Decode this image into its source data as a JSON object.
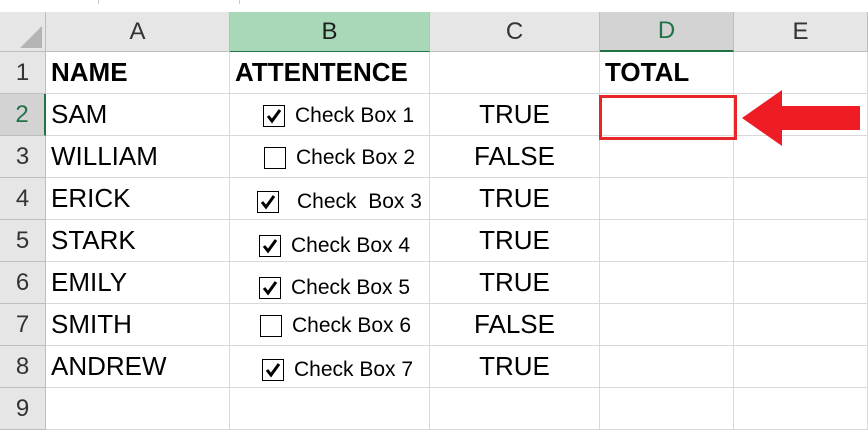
{
  "columns": [
    "A",
    "B",
    "C",
    "D",
    "E"
  ],
  "rows": [
    "1",
    "2",
    "3",
    "4",
    "5",
    "6",
    "7",
    "8",
    "9"
  ],
  "header": {
    "name": "NAME",
    "attendance": "ATTENTENCE",
    "total": "TOTAL"
  },
  "records": [
    {
      "name": "SAM",
      "checkbox_label": "Check Box 1",
      "checked": true,
      "value": "TRUE"
    },
    {
      "name": "WILLIAM",
      "checkbox_label": "Check Box 2",
      "checked": false,
      "value": "FALSE"
    },
    {
      "name": "ERICK",
      "checkbox_label": "Check  Box 3",
      "checked": true,
      "value": "TRUE"
    },
    {
      "name": "STARK",
      "checkbox_label": "Check Box 4",
      "checked": true,
      "value": "TRUE"
    },
    {
      "name": "EMILY",
      "checkbox_label": "Check Box 5",
      "checked": true,
      "value": "TRUE"
    },
    {
      "name": "SMITH",
      "checkbox_label": "Check Box 6",
      "checked": false,
      "value": "FALSE"
    },
    {
      "name": "ANDREW",
      "checkbox_label": "Check Box 7",
      "checked": true,
      "value": "TRUE"
    }
  ],
  "colors": {
    "highlight_border": "#e8262a",
    "arrow": "#ee1c25",
    "selected_column": "#a9d8b8",
    "accent": "#217346"
  },
  "icons": {
    "corner": "select-all-triangle-icon",
    "pointer": "left-arrow-icon",
    "check": "checkmark-icon"
  }
}
